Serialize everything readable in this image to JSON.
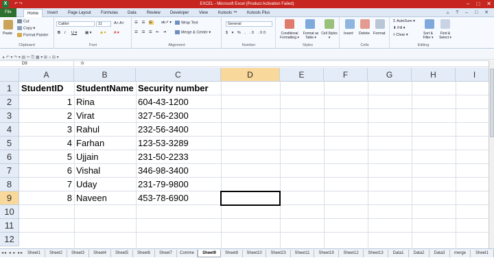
{
  "window": {
    "title": "EXCEL - Microsoft Excel (Product Activation Failed)",
    "controls": [
      "–",
      "□",
      "✕"
    ]
  },
  "ribbon_tabs": [
    "File",
    "Home",
    "Insert",
    "Page Layout",
    "Formulas",
    "Data",
    "Review",
    "Developer",
    "View",
    "Kutools ™",
    "Kutools Plus"
  ],
  "active_ribbon_tab": "Home",
  "ribbon": {
    "clipboard": {
      "paste": "Paste",
      "cut": "Cut",
      "copy": "Copy ▾",
      "format_painter": "Format Painter",
      "label": "Clipboard"
    },
    "font": {
      "name": "Calibri",
      "size": "11",
      "label": "Font"
    },
    "alignment": {
      "wrap": "Wrap Text",
      "merge": "Merge & Center ▾",
      "label": "Alignment"
    },
    "number": {
      "format": "General",
      "label": "Number"
    },
    "styles": {
      "cond": "Conditional Formatting ▾",
      "table": "Format as Table ▾",
      "cell": "Cell Styles ▾",
      "label": "Styles"
    },
    "cells": {
      "insert": "Insert",
      "delete": "Delete",
      "format": "Format",
      "label": "Cells"
    },
    "editing": {
      "autosum": "AutoSum ▾",
      "fill": "Fill ▾",
      "clear": "Clear ▾",
      "sort": "Sort & Filter ▾",
      "find": "Find & Select ▾",
      "label": "Editing"
    }
  },
  "formula_bar": {
    "name_box": "D9",
    "fx": "fx",
    "value": ""
  },
  "columns": [
    "A",
    "B",
    "C",
    "D",
    "E",
    "F",
    "G",
    "H",
    "I"
  ],
  "selected_column": "D",
  "rows": [
    "1",
    "2",
    "3",
    "4",
    "5",
    "6",
    "7",
    "8",
    "9",
    "10",
    "11",
    "12"
  ],
  "selected_row": "9",
  "table": {
    "headers": [
      "StudentID",
      "StudentName",
      "Security number"
    ],
    "records": [
      {
        "id": "1",
        "name": "Rina",
        "ssn": "604-43-1200"
      },
      {
        "id": "2",
        "name": "Virat",
        "ssn": "327-56-2300"
      },
      {
        "id": "3",
        "name": "Rahul",
        "ssn": "232-56-3400"
      },
      {
        "id": "4",
        "name": "Farhan",
        "ssn": "123-53-3289"
      },
      {
        "id": "5",
        "name": "Ujjain",
        "ssn": "231-50-2233"
      },
      {
        "id": "6",
        "name": "Vishal",
        "ssn": "346-98-3400"
      },
      {
        "id": "7",
        "name": "Uday",
        "ssn": "231-79-9800"
      },
      {
        "id": "8",
        "name": "Naveen",
        "ssn": "453-78-6900"
      }
    ]
  },
  "sheet_nav": "◂◂ ◂ ▸ ▸▸",
  "sheets": [
    "Sheet1",
    "Sheet2",
    "Sheet3",
    "Sheet4",
    "Sheet5",
    "Sheet6",
    "Sheet7",
    "Comme",
    "Sheet9",
    "Sheet8",
    "Sheet10",
    "Sheet23",
    "Sheet11",
    "Sheet19",
    "Sheet12",
    "Sheet13",
    "Data1",
    "Data2",
    "Data3",
    "merge",
    "Sheet1"
  ],
  "active_sheet": "Sheet9",
  "colors": {
    "title_bar": "#c7251f",
    "file_tab": "#2c6f2e",
    "selected_header": "#f9d99b"
  }
}
